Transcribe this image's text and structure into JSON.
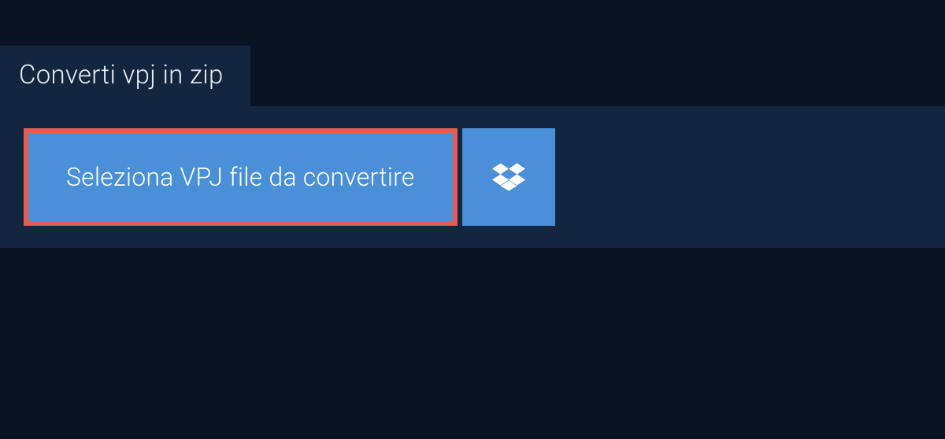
{
  "tab": {
    "title": "Converti vpj in zip"
  },
  "panel": {
    "select_button_label": "Seleziona VPJ file da convertire"
  }
}
